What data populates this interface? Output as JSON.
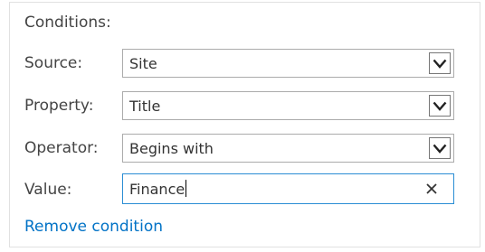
{
  "conditions": {
    "heading": "Conditions:",
    "rows": [
      {
        "label": "Source:",
        "value": "Site",
        "icon": "chevron-down-icon"
      },
      {
        "label": "Property:",
        "value": "Title",
        "icon": "chevron-down-icon"
      },
      {
        "label": "Operator:",
        "value": "Begins with",
        "icon": "chevron-down-icon"
      }
    ],
    "value_field": {
      "label": "Value:",
      "value": "Finance",
      "clear_icon": "close-icon"
    },
    "remove_link": "Remove condition"
  },
  "colors": {
    "link": "#0072c6",
    "focused_border": "#2a8dd4",
    "field_border": "#ababab"
  }
}
